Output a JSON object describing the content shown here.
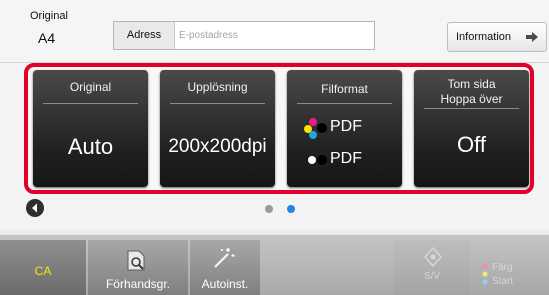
{
  "header": {
    "original_label": "Original",
    "original_value": "A4",
    "address_label": "Adress",
    "address_placeholder": "E-postadress",
    "information_label": "Information"
  },
  "tiles": [
    {
      "title": "Original",
      "value": "Auto"
    },
    {
      "title": "Upplösning",
      "value": "200x200dpi"
    },
    {
      "title": "Filformat",
      "formats": [
        "PDF",
        "PDF"
      ]
    },
    {
      "title_line1": "Tom sida",
      "title_line2": "Hoppa över",
      "value": "Off"
    }
  ],
  "pager": {
    "pages": 2,
    "active": 2
  },
  "bottom_bar": {
    "ca_label": "CA",
    "preview_label": "Förhandsgr.",
    "auto_label": "Autoinst.",
    "bw_label": "S/V",
    "color_line1": "Färg",
    "color_line2": "Start"
  },
  "colors": {
    "highlight_frame": "#e2002a",
    "tile_bg": "#262626",
    "ca_text": "#ffe400",
    "active_page_dot": "#1e88e5"
  },
  "icons": {
    "information": "arrow-right-icon",
    "scroll_left": "chevron-left-icon",
    "preview": "magnifier-document-icon",
    "auto": "magic-wand-icon",
    "bw_start": "diamond-start-icon",
    "color_start": "color-dots-icon"
  }
}
